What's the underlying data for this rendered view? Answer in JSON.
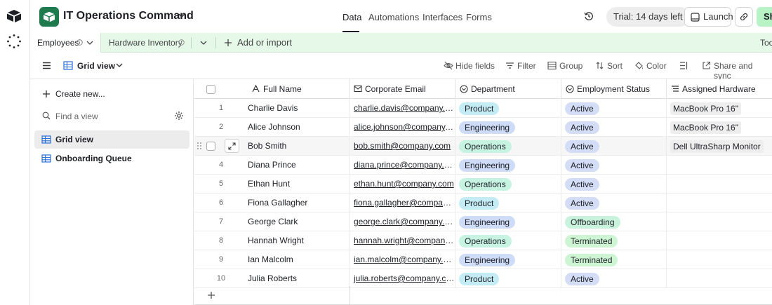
{
  "app": {
    "base_name": "IT Operations Command",
    "nav_tabs": [
      "Data",
      "Automations",
      "Interfaces",
      "Forms"
    ],
    "trial_label": "Trial: 14 days left",
    "launch_label": "Launch",
    "share_label": "Sh",
    "accent_color": "#1f7a4d",
    "share_color": "#b8f3c6"
  },
  "tables": {
    "tabs": [
      "Employees",
      "Hardware Inventory"
    ],
    "add_import_label": "Add or import",
    "tools_label": "Too"
  },
  "viewbar": {
    "view_name": "Grid view",
    "tools": [
      "Hide fields",
      "Filter",
      "Group",
      "Sort",
      "Color",
      "Share and sync"
    ]
  },
  "sidebar": {
    "create_label": "Create new...",
    "find_placeholder": "Find a view",
    "views": [
      "Grid view",
      "Onboarding Queue"
    ]
  },
  "grid": {
    "columns": [
      "Full Name",
      "Corporate Email",
      "Department",
      "Employment Status",
      "Assigned Hardware"
    ],
    "rows": [
      {
        "num": "1",
        "name": "Charlie Davis",
        "email": "charlie.davis@company.com",
        "dept": "Product",
        "status": "Active",
        "hw": "MacBook Pro 16\""
      },
      {
        "num": "2",
        "name": "Alice Johnson",
        "email": "alice.johnson@company.co...",
        "dept": "Engineering",
        "status": "Active",
        "hw": "MacBook Pro 16\""
      },
      {
        "num": "",
        "name": "Bob Smith",
        "email": "bob.smith@company.com",
        "dept": "Operations",
        "status": "Active",
        "hw": "Dell UltraSharp Monitor"
      },
      {
        "num": "4",
        "name": "Diana Prince",
        "email": "diana.prince@company.com",
        "dept": "Engineering",
        "status": "Active",
        "hw": ""
      },
      {
        "num": "5",
        "name": "Ethan Hunt",
        "email": "ethan.hunt@company.com",
        "dept": "Operations",
        "status": "Active",
        "hw": ""
      },
      {
        "num": "6",
        "name": "Fiona Gallagher",
        "email": "fiona.gallagher@company....",
        "dept": "Product",
        "status": "Active",
        "hw": ""
      },
      {
        "num": "7",
        "name": "George Clark",
        "email": "george.clark@company.com",
        "dept": "Engineering",
        "status": "Offboarding",
        "hw": ""
      },
      {
        "num": "8",
        "name": "Hannah Wright",
        "email": "hannah.wright@company.c...",
        "dept": "Operations",
        "status": "Terminated",
        "hw": ""
      },
      {
        "num": "9",
        "name": "Ian Malcolm",
        "email": "ian.malcolm@company.com",
        "dept": "Engineering",
        "status": "Terminated",
        "hw": ""
      },
      {
        "num": "10",
        "name": "Julia Roberts",
        "email": "julia.roberts@company.com",
        "dept": "Product",
        "status": "Active",
        "hw": ""
      }
    ],
    "pill_colors": {
      "Product": "#c4ecf5",
      "Engineering": "#cfdcf7",
      "Operations": "#c6f3e2",
      "Active": "#d3ddf6",
      "Offboarding": "#c8f2dc",
      "Terminated": "#cdf5d3"
    }
  }
}
